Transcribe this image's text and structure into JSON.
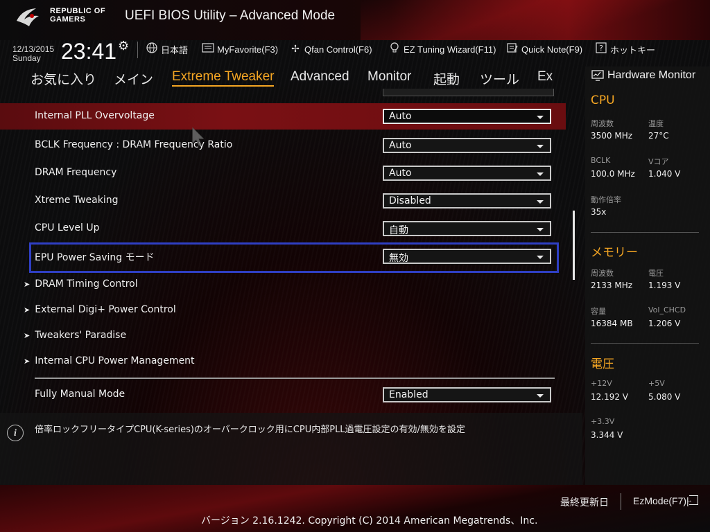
{
  "header": {
    "brand_line1": "REPUBLIC OF",
    "brand_line2": "GAMERS",
    "title": "UEFI BIOS Utility – Advanced Mode"
  },
  "topbar": {
    "date": "12/13/2015",
    "weekday": "Sunday",
    "time": "23:41",
    "items": [
      {
        "icon": "globe-icon",
        "label": "日本語"
      },
      {
        "icon": "favorites-icon",
        "label": "MyFavorite(F3)"
      },
      {
        "icon": "fan-icon",
        "label": "Qfan Control(F6)"
      },
      {
        "icon": "lightbulb-icon",
        "label": "EZ Tuning Wizard(F11)"
      },
      {
        "icon": "note-icon",
        "label": "Quick Note(F9)"
      },
      {
        "icon": "help-icon",
        "label": "ホットキー"
      }
    ]
  },
  "tabs": [
    "お気に入り",
    "メイン",
    "Extreme Tweaker",
    "Advanced",
    "Monitor",
    "起動",
    "ツール",
    "Ex"
  ],
  "active_tab": "Extreme Tweaker",
  "settings": [
    {
      "label": "Internal PLL Overvoltage",
      "value": "Auto",
      "highlighted": true
    },
    {
      "label": "BCLK Frequency : DRAM Frequency Ratio",
      "value": "Auto"
    },
    {
      "label": "DRAM Frequency",
      "value": "Auto"
    },
    {
      "label": "Xtreme Tweaking",
      "value": "Disabled"
    },
    {
      "label": "CPU Level Up",
      "value": "自動"
    },
    {
      "label": "EPU Power Saving モード",
      "value": "無効",
      "focused": true
    }
  ],
  "submenus": [
    "DRAM Timing Control",
    "External Digi+ Power Control",
    "Tweakers' Paradise",
    "Internal CPU Power Management"
  ],
  "fully_manual": {
    "label": "Fully Manual Mode",
    "value": "Enabled"
  },
  "help_text": "倍率ロックフリータイプCPU(K-series)のオーバークロック用にCPU内部PLL過電圧設定の有効/無効を設定",
  "hardware_monitor": {
    "title": "Hardware Monitor",
    "cpu": {
      "heading": "CPU",
      "freq_label": "周波数",
      "freq": "3500 MHz",
      "temp_label": "温度",
      "temp": "27°C",
      "bclk_label": "BCLK",
      "bclk": "100.0 MHz",
      "vcore_label": "Vコア",
      "vcore": "1.040 V",
      "ratio_label": "動作倍率",
      "ratio": "35x"
    },
    "memory": {
      "heading": "メモリー",
      "freq_label": "周波数",
      "freq": "2133 MHz",
      "volt_label": "電圧",
      "volt": "1.193 V",
      "cap_label": "容量",
      "cap": "16384 MB",
      "vol_chcd_label": "Vol_CHCD",
      "vol_chcd": "1.206 V"
    },
    "voltage": {
      "heading": "電圧",
      "v12_label": "+12V",
      "v12": "12.192 V",
      "v5_label": "+5V",
      "v5": "5.080 V",
      "v33_label": "+3.3V",
      "v33": "3.344 V"
    }
  },
  "footer": {
    "last_modified": "最終更新日",
    "ezmode": "EzMode(F7)|",
    "version": "バージョン 2.16.1242. Copyright (C) 2014 American Megatrends、Inc."
  },
  "colors": {
    "accent": "#f5a623",
    "highlight_row": "#7a1014",
    "focus_border": "#2f3fc4"
  }
}
